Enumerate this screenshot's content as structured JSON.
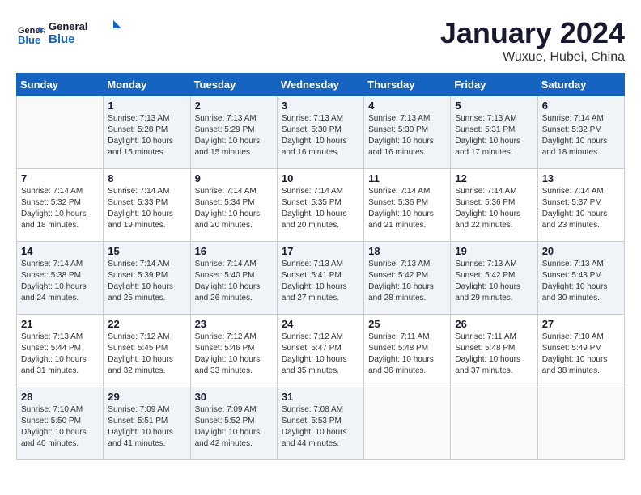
{
  "header": {
    "logo_line1": "General",
    "logo_line2": "Blue",
    "month_title": "January 2024",
    "location": "Wuxue, Hubei, China"
  },
  "weekdays": [
    "Sunday",
    "Monday",
    "Tuesday",
    "Wednesday",
    "Thursday",
    "Friday",
    "Saturday"
  ],
  "weeks": [
    [
      {
        "day": "",
        "info": ""
      },
      {
        "day": "1",
        "info": "Sunrise: 7:13 AM\nSunset: 5:28 PM\nDaylight: 10 hours\nand 15 minutes."
      },
      {
        "day": "2",
        "info": "Sunrise: 7:13 AM\nSunset: 5:29 PM\nDaylight: 10 hours\nand 15 minutes."
      },
      {
        "day": "3",
        "info": "Sunrise: 7:13 AM\nSunset: 5:30 PM\nDaylight: 10 hours\nand 16 minutes."
      },
      {
        "day": "4",
        "info": "Sunrise: 7:13 AM\nSunset: 5:30 PM\nDaylight: 10 hours\nand 16 minutes."
      },
      {
        "day": "5",
        "info": "Sunrise: 7:13 AM\nSunset: 5:31 PM\nDaylight: 10 hours\nand 17 minutes."
      },
      {
        "day": "6",
        "info": "Sunrise: 7:14 AM\nSunset: 5:32 PM\nDaylight: 10 hours\nand 18 minutes."
      }
    ],
    [
      {
        "day": "7",
        "info": "Sunrise: 7:14 AM\nSunset: 5:32 PM\nDaylight: 10 hours\nand 18 minutes."
      },
      {
        "day": "8",
        "info": "Sunrise: 7:14 AM\nSunset: 5:33 PM\nDaylight: 10 hours\nand 19 minutes."
      },
      {
        "day": "9",
        "info": "Sunrise: 7:14 AM\nSunset: 5:34 PM\nDaylight: 10 hours\nand 20 minutes."
      },
      {
        "day": "10",
        "info": "Sunrise: 7:14 AM\nSunset: 5:35 PM\nDaylight: 10 hours\nand 20 minutes."
      },
      {
        "day": "11",
        "info": "Sunrise: 7:14 AM\nSunset: 5:36 PM\nDaylight: 10 hours\nand 21 minutes."
      },
      {
        "day": "12",
        "info": "Sunrise: 7:14 AM\nSunset: 5:36 PM\nDaylight: 10 hours\nand 22 minutes."
      },
      {
        "day": "13",
        "info": "Sunrise: 7:14 AM\nSunset: 5:37 PM\nDaylight: 10 hours\nand 23 minutes."
      }
    ],
    [
      {
        "day": "14",
        "info": "Sunrise: 7:14 AM\nSunset: 5:38 PM\nDaylight: 10 hours\nand 24 minutes."
      },
      {
        "day": "15",
        "info": "Sunrise: 7:14 AM\nSunset: 5:39 PM\nDaylight: 10 hours\nand 25 minutes."
      },
      {
        "day": "16",
        "info": "Sunrise: 7:14 AM\nSunset: 5:40 PM\nDaylight: 10 hours\nand 26 minutes."
      },
      {
        "day": "17",
        "info": "Sunrise: 7:13 AM\nSunset: 5:41 PM\nDaylight: 10 hours\nand 27 minutes."
      },
      {
        "day": "18",
        "info": "Sunrise: 7:13 AM\nSunset: 5:42 PM\nDaylight: 10 hours\nand 28 minutes."
      },
      {
        "day": "19",
        "info": "Sunrise: 7:13 AM\nSunset: 5:42 PM\nDaylight: 10 hours\nand 29 minutes."
      },
      {
        "day": "20",
        "info": "Sunrise: 7:13 AM\nSunset: 5:43 PM\nDaylight: 10 hours\nand 30 minutes."
      }
    ],
    [
      {
        "day": "21",
        "info": "Sunrise: 7:13 AM\nSunset: 5:44 PM\nDaylight: 10 hours\nand 31 minutes."
      },
      {
        "day": "22",
        "info": "Sunrise: 7:12 AM\nSunset: 5:45 PM\nDaylight: 10 hours\nand 32 minutes."
      },
      {
        "day": "23",
        "info": "Sunrise: 7:12 AM\nSunset: 5:46 PM\nDaylight: 10 hours\nand 33 minutes."
      },
      {
        "day": "24",
        "info": "Sunrise: 7:12 AM\nSunset: 5:47 PM\nDaylight: 10 hours\nand 35 minutes."
      },
      {
        "day": "25",
        "info": "Sunrise: 7:11 AM\nSunset: 5:48 PM\nDaylight: 10 hours\nand 36 minutes."
      },
      {
        "day": "26",
        "info": "Sunrise: 7:11 AM\nSunset: 5:48 PM\nDaylight: 10 hours\nand 37 minutes."
      },
      {
        "day": "27",
        "info": "Sunrise: 7:10 AM\nSunset: 5:49 PM\nDaylight: 10 hours\nand 38 minutes."
      }
    ],
    [
      {
        "day": "28",
        "info": "Sunrise: 7:10 AM\nSunset: 5:50 PM\nDaylight: 10 hours\nand 40 minutes."
      },
      {
        "day": "29",
        "info": "Sunrise: 7:09 AM\nSunset: 5:51 PM\nDaylight: 10 hours\nand 41 minutes."
      },
      {
        "day": "30",
        "info": "Sunrise: 7:09 AM\nSunset: 5:52 PM\nDaylight: 10 hours\nand 42 minutes."
      },
      {
        "day": "31",
        "info": "Sunrise: 7:08 AM\nSunset: 5:53 PM\nDaylight: 10 hours\nand 44 minutes."
      },
      {
        "day": "",
        "info": ""
      },
      {
        "day": "",
        "info": ""
      },
      {
        "day": "",
        "info": ""
      }
    ]
  ]
}
